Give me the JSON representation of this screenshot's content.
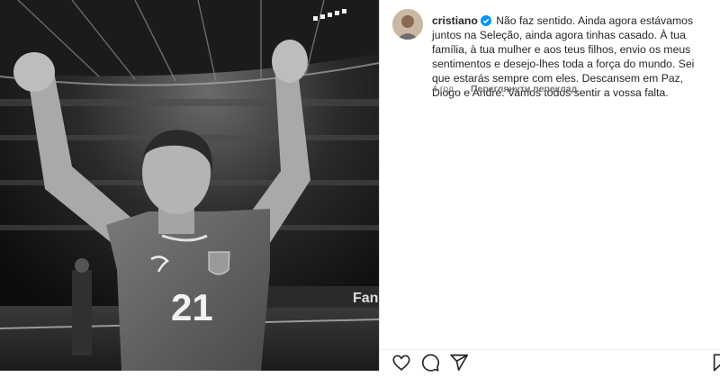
{
  "post": {
    "username": "cristiano",
    "verified": true,
    "caption": "Não faz sentido. Ainda agora estávamos juntos na Seleção, ainda agora tinhas casado. À tua família, à tua mulher e aos teus filhos, envio os meus sentimentos e desejo-lhes toda a força do mundo. Sei que estarás sempre com eles. Descansem em Paz, Diogo e André. Vamos todos sentir a vossa falta.",
    "time_ago": "4 год.",
    "translate_label": "Переглянути переклад"
  },
  "image": {
    "jersey_number": "21",
    "board_text": "Fan"
  },
  "actions": {
    "like_icon": "heart-icon",
    "comment_icon": "comment-icon",
    "share_icon": "share-icon",
    "save_icon": "bookmark-icon"
  },
  "colors": {
    "verified_badge": "#0095f6",
    "text": "#262626",
    "secondary_text": "#737373"
  }
}
